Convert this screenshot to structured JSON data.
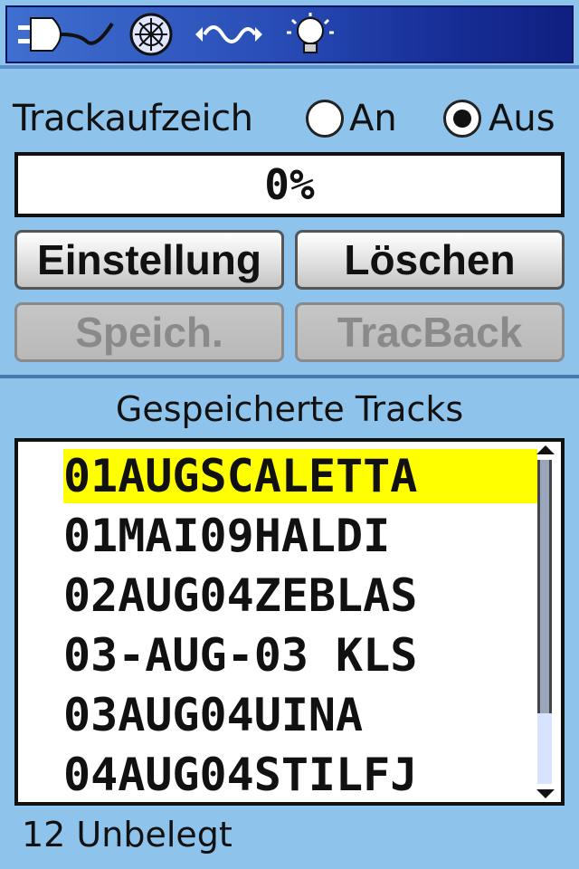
{
  "status_icons": [
    "power-plug-icon",
    "satellite-icon",
    "signal-wave-icon",
    "backlight-bulb-icon"
  ],
  "track_recording": {
    "label": "Trackaufzeich",
    "option_on": "An",
    "option_off": "Aus",
    "selected": "Aus"
  },
  "progress": {
    "text": "0%",
    "value": 0
  },
  "buttons": {
    "settings": "Einstellung",
    "delete": "Löschen",
    "save": "Speich.",
    "tracback": "TracBack"
  },
  "saved_tracks": {
    "title": "Gespeicherte Tracks",
    "items": [
      "01AUGSCALETTA",
      "01MAI09HALDI",
      "02AUG04ZEBLAS",
      "03-AUG-03 KLS",
      "03AUG04UINA",
      "04AUG04STILFJ"
    ],
    "selected_index": 0
  },
  "footer": {
    "free_text": "12 Unbelegt"
  },
  "colors": {
    "background": "#8ec3ec",
    "highlight": "#ffff00",
    "statusbar": "#2a4fb8"
  }
}
